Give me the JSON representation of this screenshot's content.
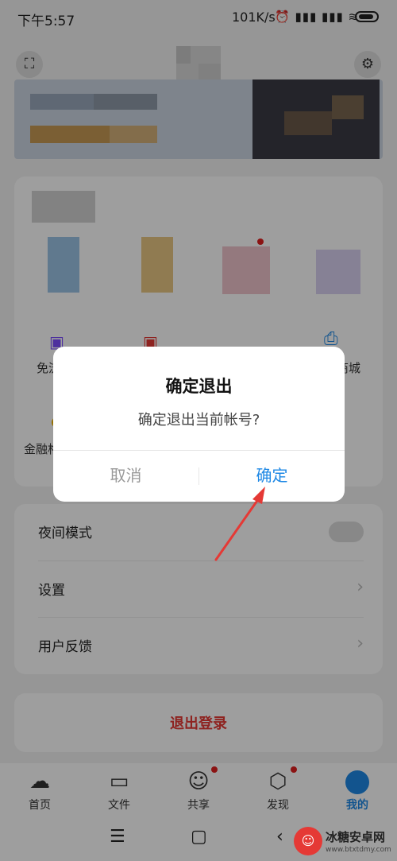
{
  "status_bar": {
    "time": "下午5:57",
    "speed": "101K/s",
    "icons": "⏰ ▮▮▮ ▮▮▮ ≋"
  },
  "grid": {
    "row2_left_label": "免流",
    "row2_right_label": "商城",
    "row3_left_label": "金融格"
  },
  "menu": {
    "night_mode": "夜间模式",
    "settings": "设置",
    "feedback": "用户反馈",
    "logout": "退出登录"
  },
  "dialog": {
    "title": "确定退出",
    "message": "确定退出当前帐号?",
    "cancel": "取消",
    "confirm": "确定"
  },
  "tabs": [
    {
      "label": "首页",
      "icon": "cloud-icon"
    },
    {
      "label": "文件",
      "icon": "folder-icon"
    },
    {
      "label": "共享",
      "icon": "people-icon"
    },
    {
      "label": "发现",
      "icon": "discover-icon"
    },
    {
      "label": "我的",
      "icon": "avatar-icon"
    }
  ],
  "watermark": {
    "name": "冰糖安卓网",
    "url": "www.btxtdmy.com"
  },
  "colors": {
    "accent": "#1e88e5",
    "danger": "#e53935",
    "dialog_confirm": "#1e88e5",
    "dialog_cancel": "#999999",
    "arrow": "#e53935"
  }
}
